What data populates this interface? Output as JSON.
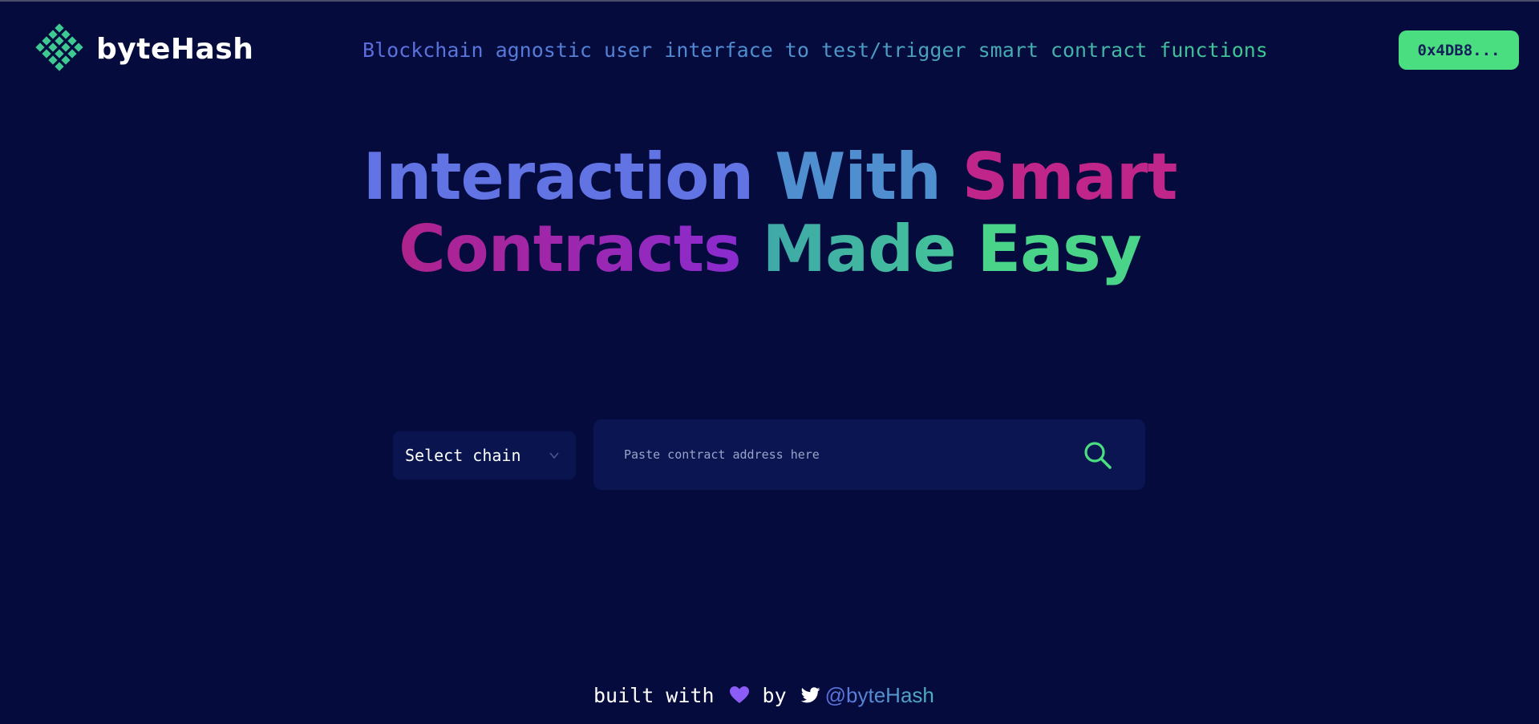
{
  "header": {
    "brand_name": "byteHash",
    "logo_icon": "diamond-grid-logo-icon",
    "tagline": "Blockchain agnostic user interface to test/trigger smart contract functions",
    "wallet_label": "0x4DB8..."
  },
  "hero": {
    "line1": {
      "w1": "Interaction",
      "w2": "With",
      "w3": "Smart"
    },
    "line2": {
      "w4": "Contracts",
      "w5": "Made",
      "w6": "Easy"
    }
  },
  "search": {
    "chain_select_label": "Select chain",
    "address_placeholder": "Paste contract address here",
    "address_value": ""
  },
  "footer": {
    "built_with": "built with",
    "by": "by",
    "handle": "@byteHash",
    "heart_icon": "heart-icon",
    "twitter_icon": "twitter-icon"
  },
  "colors": {
    "background": "#050c3d",
    "accent_green": "#4ade80",
    "panel": "#0a1552",
    "magenta": "#c0258a",
    "violet": "#8a2bd0",
    "blue": "#6273e3"
  }
}
